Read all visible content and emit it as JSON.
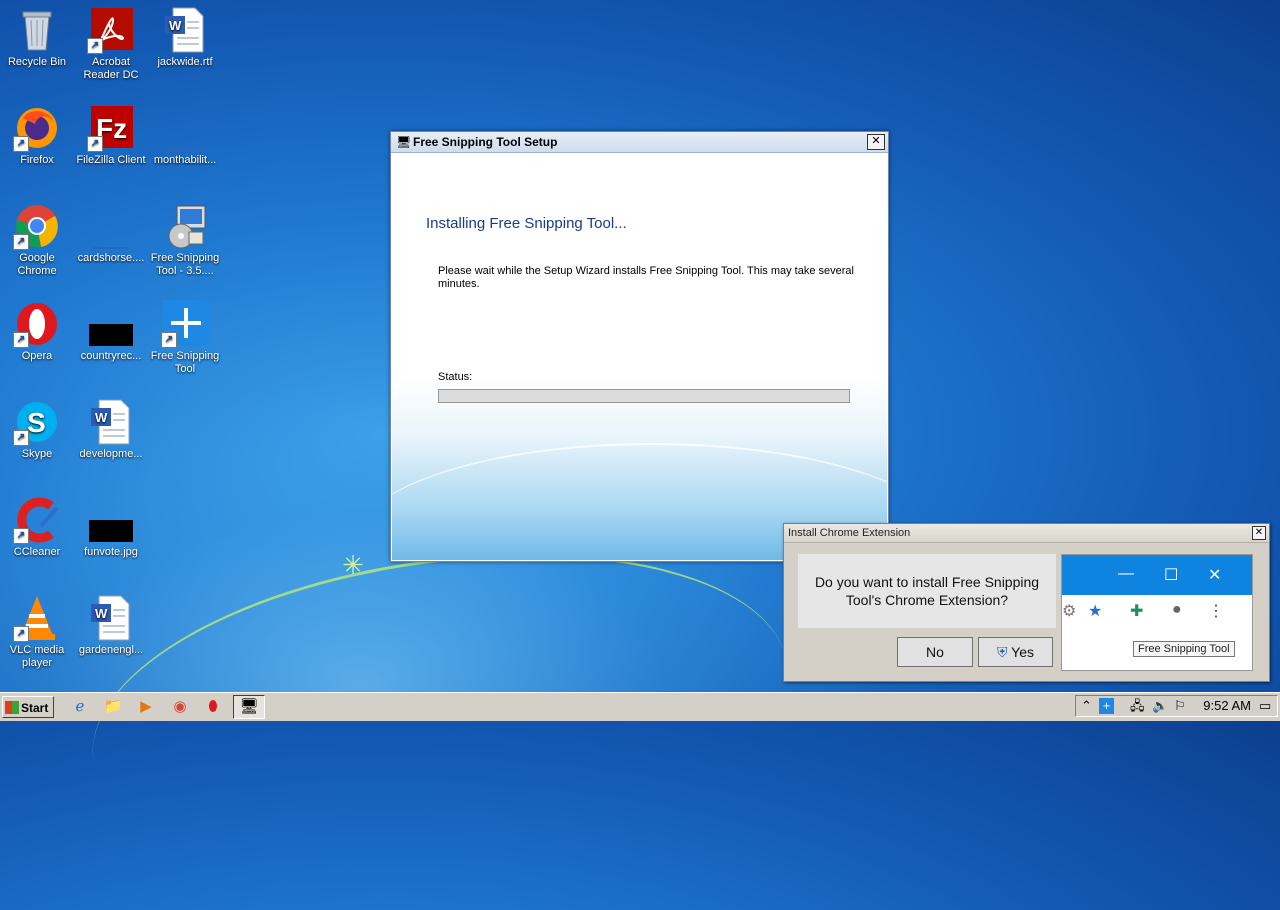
{
  "desktop": {
    "icons": [
      {
        "label": "Recycle Bin",
        "icon": "recycle-bin-icon"
      },
      {
        "label": "Acrobat Reader DC",
        "icon": "acrobat-icon"
      },
      {
        "label": "jackwide.rtf",
        "icon": "word-doc-icon"
      },
      {
        "label": "Firefox",
        "icon": "firefox-icon"
      },
      {
        "label": "FileZilla Client",
        "icon": "filezilla-icon"
      },
      {
        "label": "monthabilit...",
        "icon": "blank-file-icon"
      },
      {
        "label": "Google Chrome",
        "icon": "chrome-icon"
      },
      {
        "label": "cardshorse....",
        "icon": "blank-file-icon"
      },
      {
        "label": "Free Snipping Tool - 3.5....",
        "icon": "installer-icon"
      },
      {
        "label": "Opera",
        "icon": "opera-icon"
      },
      {
        "label": "countryrec...",
        "icon": "black-file-icon"
      },
      {
        "label": "Free Snipping Tool",
        "icon": "snipping-tool-icon"
      },
      {
        "label": "Skype",
        "icon": "skype-icon"
      },
      {
        "label": "developme...",
        "icon": "word-doc-icon"
      },
      {
        "label": "CCleaner",
        "icon": "ccleaner-icon"
      },
      {
        "label": "funvote.jpg",
        "icon": "black-file-icon"
      },
      {
        "label": "VLC media player",
        "icon": "vlc-icon"
      },
      {
        "label": "gardenengl...",
        "icon": "word-doc-icon"
      }
    ]
  },
  "setup_window": {
    "title": "Free Snipping Tool Setup",
    "close_glyph": "✕",
    "heading": "Installing Free Snipping Tool...",
    "description": "Please wait while the Setup Wizard installs Free Snipping Tool.  This may take several minutes.",
    "status_label": "Status:",
    "progress_fraction": 0
  },
  "chrome_extension_dialog": {
    "title": "Install Chrome Extension",
    "close_glyph": "✕",
    "question": "Do you want to install Free Snipping Tool's Chrome Extension?",
    "no_label": "No",
    "yes_label": "Yes",
    "preview_tooltip": "Free Snipping Tool"
  },
  "taskbar": {
    "start_label": "Start",
    "clock": "9:52 AM"
  },
  "colors": {
    "desktop_blue": "#1f78d0",
    "title_text": "#1a3a8a",
    "chrome_bar": "#0f83e0"
  }
}
